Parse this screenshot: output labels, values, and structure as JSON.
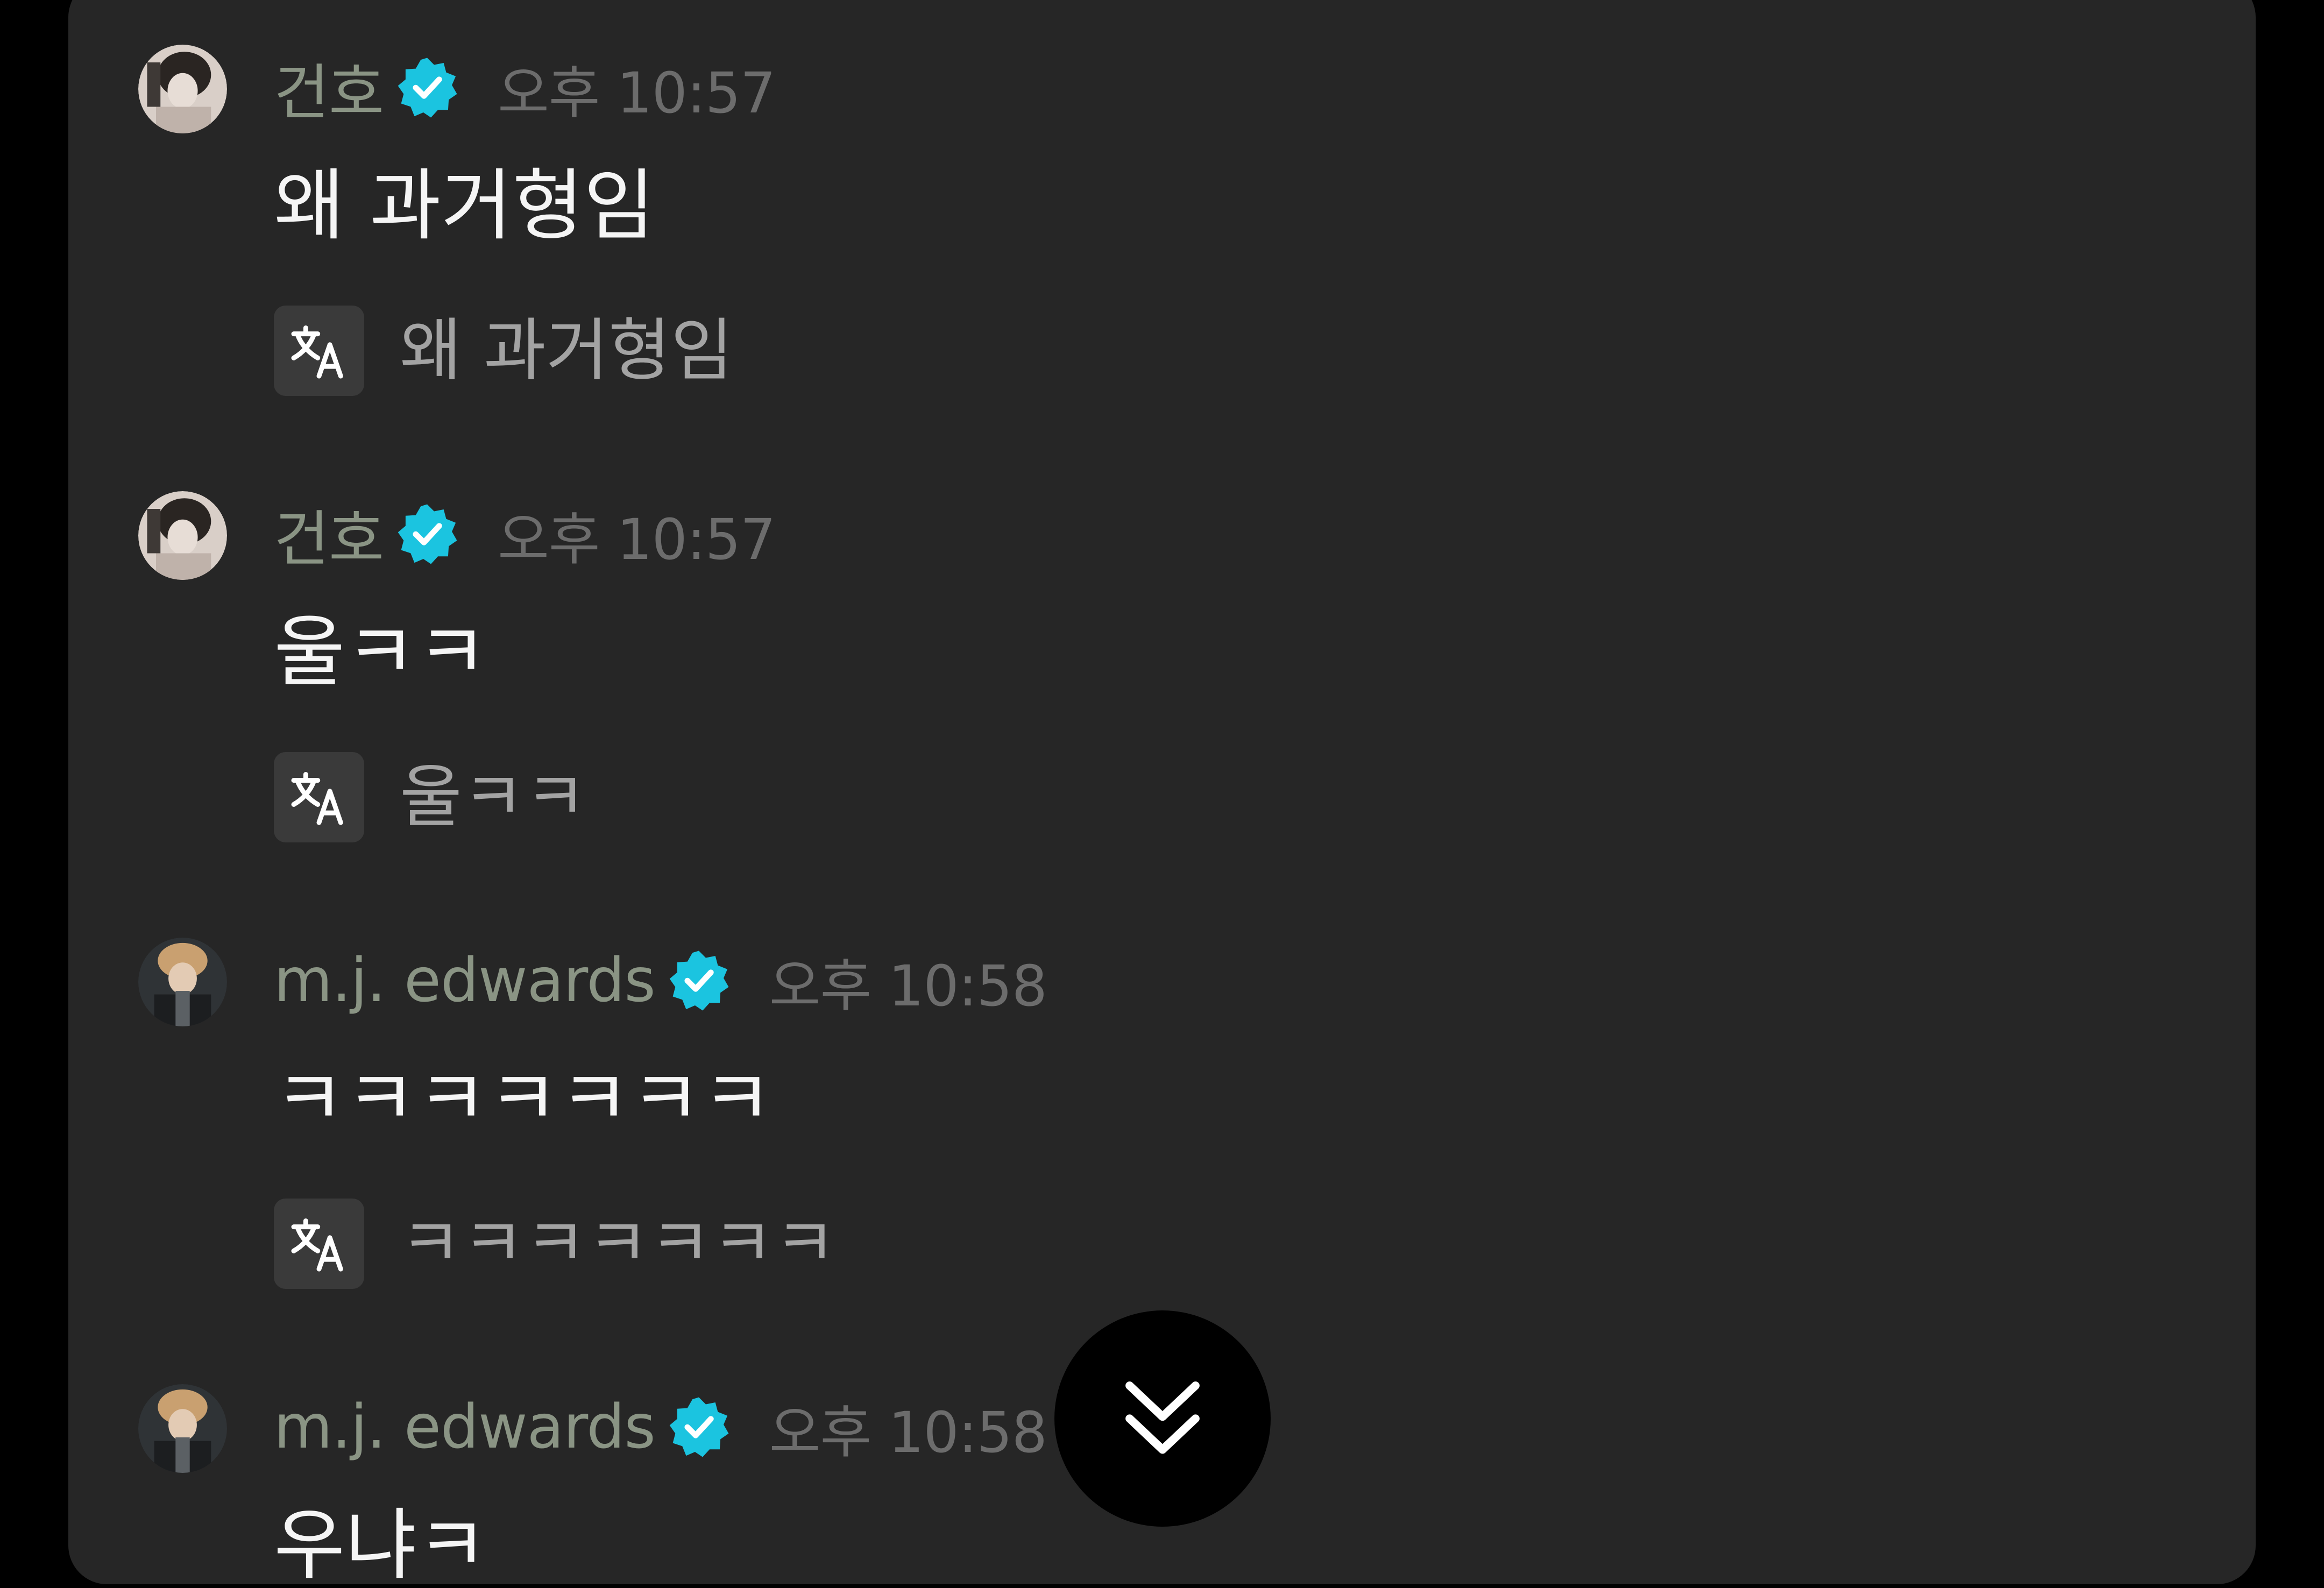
{
  "messages": [
    {
      "username": "건호",
      "time": "오후 10:57",
      "text": "왜 과거형임",
      "translation": "왜 과거형임",
      "avatar_icon": "user-avatar-icon"
    },
    {
      "username": "건호",
      "time": "오후 10:57",
      "text": "울ㅋㅋ",
      "translation": "울ㅋㅋ",
      "avatar_icon": "user-avatar-icon"
    },
    {
      "username": "m.j. edwards",
      "time": "오후 10:58",
      "text": "ㅋㅋㅋㅋㅋㅋㅋ",
      "translation": "ㅋㅋㅋㅋㅋㅋㅋ",
      "avatar_icon": "user-avatar-icon"
    },
    {
      "username": "m.j. edwards",
      "time": "오후 10:58",
      "text": "우냐ㅋ",
      "avatar_icon": "user-avatar-icon"
    }
  ],
  "icons": {
    "verified": "verified-badge-icon",
    "translate": "translate-icon",
    "scroll": "double-chevron-down-icon"
  },
  "colors": {
    "background": "#000000",
    "panel": "#262626",
    "username": "#8a9484",
    "timestamp": "#6c6c6c",
    "message_text": "#f5f5f5",
    "translation_text": "#a3a3a3",
    "translate_button": "#3a3a3a",
    "verified_badge": "#1bc4e0"
  }
}
